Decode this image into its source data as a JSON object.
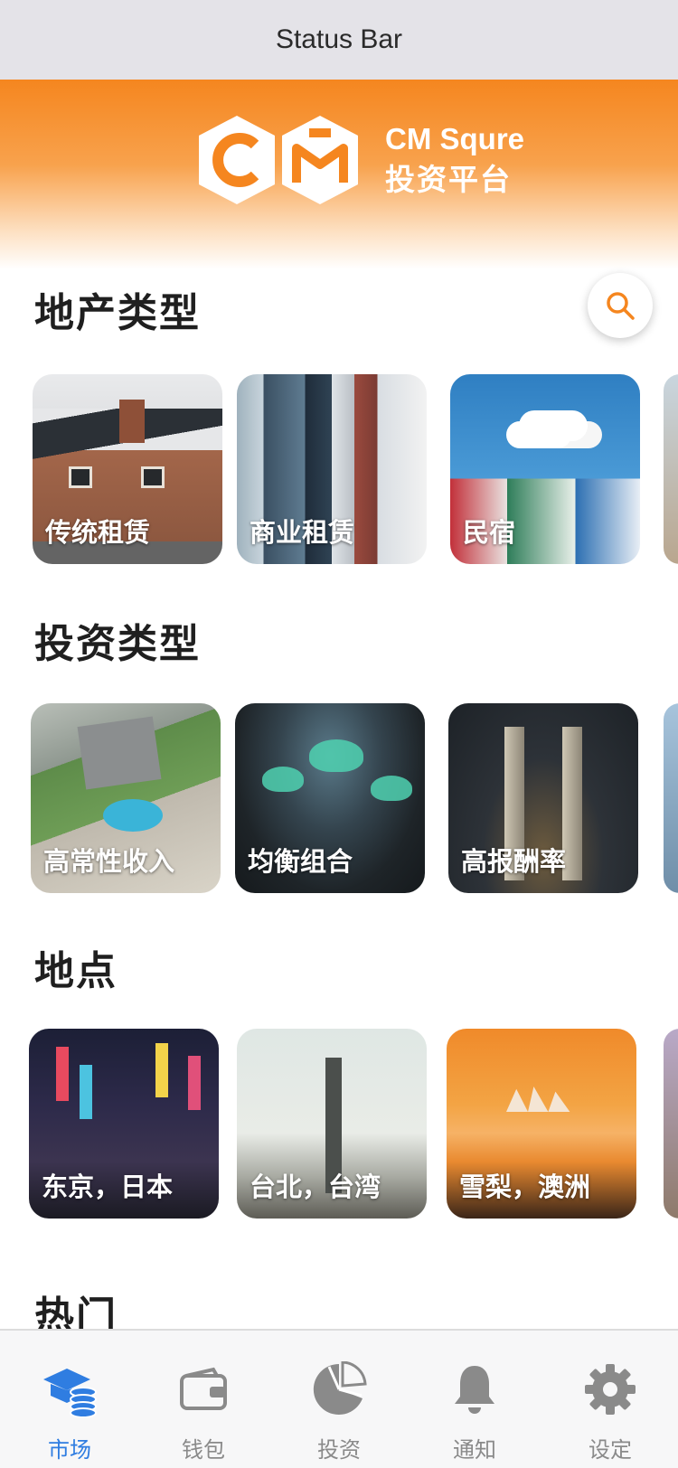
{
  "status_bar": {
    "text": "Status Bar"
  },
  "header": {
    "brand_name": "CM Squre",
    "brand_sub": "投资平台"
  },
  "sections": [
    {
      "title": "地产类型",
      "cards": [
        {
          "label": "传统租赁"
        },
        {
          "label": "商业租赁"
        },
        {
          "label": "民宿"
        }
      ]
    },
    {
      "title": "投资类型",
      "cards": [
        {
          "label": "高常性收入"
        },
        {
          "label": "均衡组合"
        },
        {
          "label": "高报酬率"
        }
      ]
    },
    {
      "title": "地点",
      "cards": [
        {
          "label": "东京，日本"
        },
        {
          "label": "台北，台湾"
        },
        {
          "label": "雪梨，澳洲"
        }
      ]
    },
    {
      "title": "热门",
      "cards": []
    }
  ],
  "search": {
    "icon": "search-icon"
  },
  "tabbar": {
    "active": "市场",
    "items": [
      {
        "label": "市场",
        "icon": "market-coins-icon"
      },
      {
        "label": "钱包",
        "icon": "wallet-icon"
      },
      {
        "label": "投资",
        "icon": "pie-chart-icon"
      },
      {
        "label": "通知",
        "icon": "bell-icon"
      },
      {
        "label": "设定",
        "icon": "gear-icon"
      }
    ]
  },
  "colors": {
    "brand_orange": "#f5861f",
    "tab_active": "#2f7de1",
    "tab_inactive": "#8a8a8a"
  }
}
